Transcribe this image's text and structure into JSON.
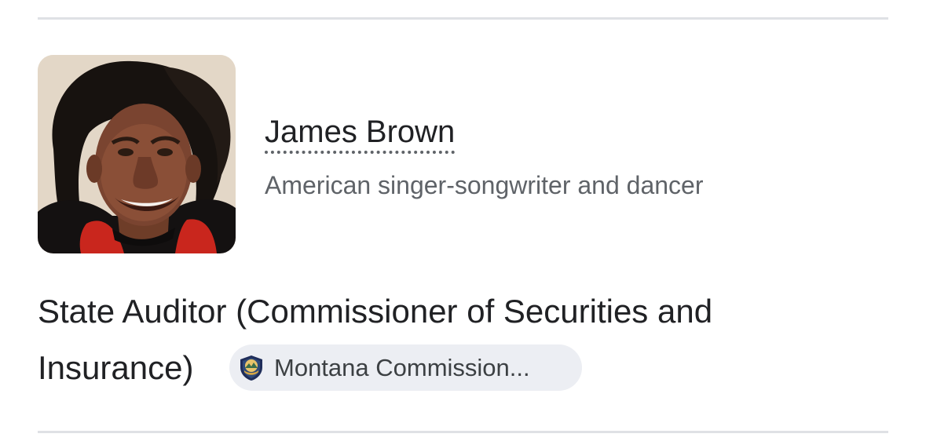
{
  "entity": {
    "name": "James Brown",
    "description": "American singer-songwriter and dancer",
    "photo_icon": "portrait-photo"
  },
  "role": {
    "line1": "State Auditor (Commissioner of Securities and",
    "line2": "Insurance)"
  },
  "source_chip": {
    "label": "Montana Commission...",
    "icon": "montana-seal-icon"
  },
  "colors": {
    "divider": "#dfe1e5",
    "chip_background": "#eceef3",
    "subtitle_text": "#5f6368",
    "primary_text": "#202124"
  }
}
